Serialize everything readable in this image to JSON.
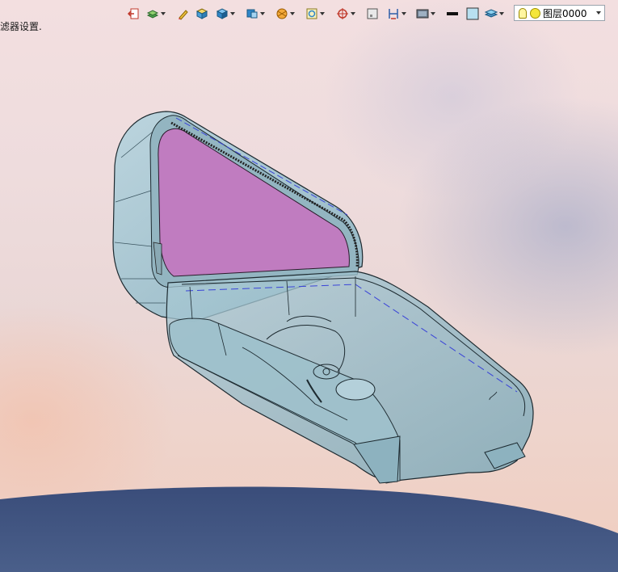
{
  "status": {
    "text": "滤器设置."
  },
  "toolbar": {
    "icons": [
      "exit-sketch-icon",
      "layers-icon",
      "pencil-icon",
      "box-icon",
      "cube-icon",
      "view-orientation-icon",
      "section-icon",
      "zoom-fit-icon",
      "move-icon",
      "frame-icon",
      "dimension-icon",
      "display-icon",
      "line-color-icon",
      "fill-color-icon",
      "layer-stack-icon"
    ],
    "layer": {
      "name": "图层0000"
    }
  },
  "colors": {
    "interior": "#c07cc0",
    "shell": "#a7c8d3",
    "ground": "#3f527b"
  }
}
